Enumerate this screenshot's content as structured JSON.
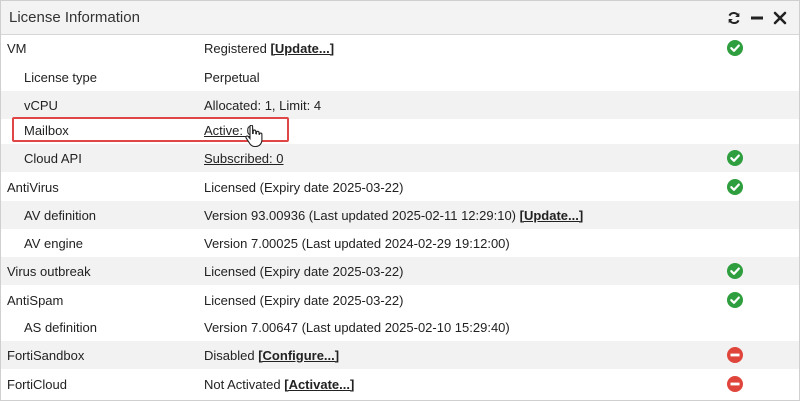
{
  "panel": {
    "title": "License Information",
    "icons": [
      "refresh-icon",
      "minimize-icon",
      "close-icon"
    ]
  },
  "rows": [
    {
      "label": "VM",
      "value": "Registered",
      "link": "[Update...]",
      "status": "ok"
    },
    {
      "label": "License type",
      "value": "Perpetual"
    },
    {
      "label": "vCPU",
      "value": "Allocated: 1, Limit: 4"
    },
    {
      "label": "Mailbox",
      "link_value": "Active: 0"
    },
    {
      "label": "Cloud API",
      "link_value": "Subscribed: 0",
      "status": "ok"
    },
    {
      "label": "AntiVirus",
      "value": "Licensed (Expiry date 2025-03-22)",
      "status": "ok"
    },
    {
      "label": "AV definition",
      "value": "Version 93.00936 (Last updated 2025-02-11 12:29:10)",
      "link": "[Update...]"
    },
    {
      "label": "AV engine",
      "value": "Version 7.00025 (Last updated 2024-02-29 19:12:00)"
    },
    {
      "label": "Virus outbreak",
      "value": "Licensed (Expiry date 2025-03-22)",
      "status": "ok"
    },
    {
      "label": "AntiSpam",
      "value": "Licensed (Expiry date 2025-03-22)",
      "status": "ok"
    },
    {
      "label": "AS definition",
      "value": "Version 7.00647 (Last updated 2025-02-10 15:29:40)"
    },
    {
      "label": "FortiSandbox",
      "value": "Disabled",
      "link": "[Configure...]",
      "status": "disabled"
    },
    {
      "label": "FortiCloud",
      "value": "Not Activated",
      "link": "[Activate...]",
      "status": "disabled"
    }
  ],
  "colors": {
    "ok": "#2e9e3f",
    "disabled": "#e0453c",
    "highlight": "#e04646"
  }
}
